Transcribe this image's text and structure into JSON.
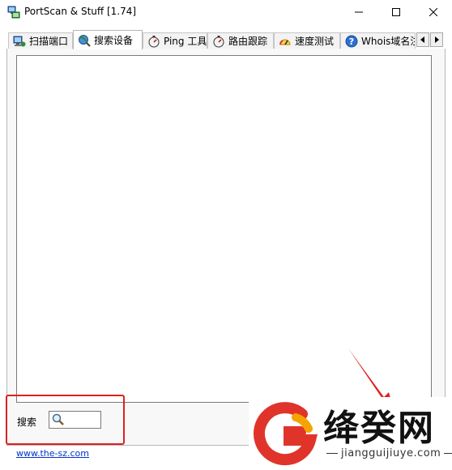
{
  "window": {
    "title": "PortScan & Stuff [1.74]"
  },
  "tabs": [
    {
      "label": "扫描端口",
      "icon": "network-computer-icon"
    },
    {
      "label": "搜索设备",
      "icon": "globe-search-icon",
      "active": true
    },
    {
      "label": "Ping 工具",
      "icon": "stopwatch-icon"
    },
    {
      "label": "路由跟踪",
      "icon": "stopwatch-icon"
    },
    {
      "label": "速度测试",
      "icon": "speedometer-icon"
    },
    {
      "label": "Whois域名注",
      "icon": "help-circle-icon"
    }
  ],
  "search": {
    "label": "搜索",
    "value": ""
  },
  "footer": {
    "link": "www.the-sz.com"
  },
  "watermark": {
    "title": "绛癸网",
    "url": "jiangguijiuye.com"
  },
  "colors": {
    "highlight_frame": "#e02020",
    "link": "#0033cc"
  }
}
